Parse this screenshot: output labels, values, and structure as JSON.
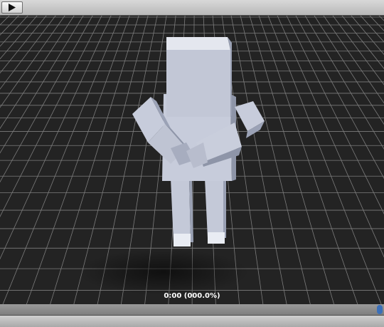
{
  "player": {
    "play_icon": "play-icon",
    "timecode": "0:00 (000.0%)",
    "progress": 0.0
  },
  "colors": {
    "figure": "#c7ccdb",
    "figure_shade": "#9ba2b6",
    "figure_dark": "#7e8497",
    "grid_floor": "#242424",
    "grid_line": "#8a8a8a",
    "accent": "#3b78c9"
  }
}
